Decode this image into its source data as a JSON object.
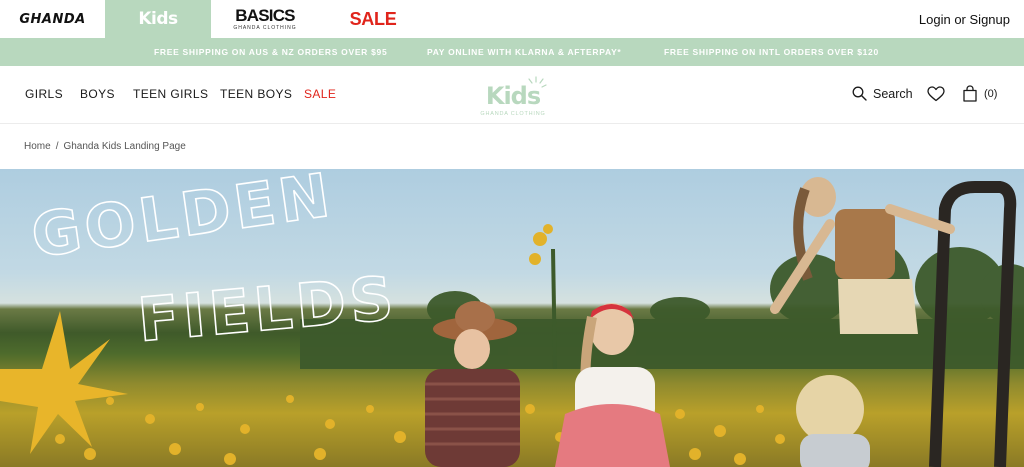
{
  "brand_bar": {
    "tabs": [
      {
        "label": "GHANDA"
      },
      {
        "label": "Kids"
      },
      {
        "label": "BASICS",
        "sublabel": "GHANDA CLOTHING"
      },
      {
        "label": "SALE"
      }
    ],
    "login": {
      "login_label": "Login",
      "or_label": " or ",
      "signup_label": "Signup"
    }
  },
  "announcement": {
    "messages": [
      "FREE SHIPPING ON AUS & NZ ORDERS OVER $95",
      "PAY ONLINE WITH KLARNA & AFTERPAY*",
      "FREE SHIPPING ON INTL ORDERS OVER $120"
    ],
    "background": "#b8d8be"
  },
  "nav": {
    "items": [
      {
        "label": "GIRLS"
      },
      {
        "label": "BOYS"
      },
      {
        "label": "TEEN GIRLS"
      },
      {
        "label": "TEEN BOYS"
      },
      {
        "label": "SALE",
        "color": "#e0241b"
      }
    ],
    "logo": {
      "text": "Kids",
      "subtext": "GHANDA CLOTHING"
    },
    "search_label": "Search",
    "cart_count": "(0)"
  },
  "breadcrumb": {
    "items": [
      "Home",
      "Ghanda Kids Landing Page"
    ],
    "separator": "/"
  },
  "hero": {
    "heading_line1": "GOLDEN",
    "heading_line2": "FIELDS"
  },
  "colors": {
    "accent_mint": "#b8d8be",
    "sale_red": "#e0241b",
    "star_yellow": "#e8b52a"
  }
}
